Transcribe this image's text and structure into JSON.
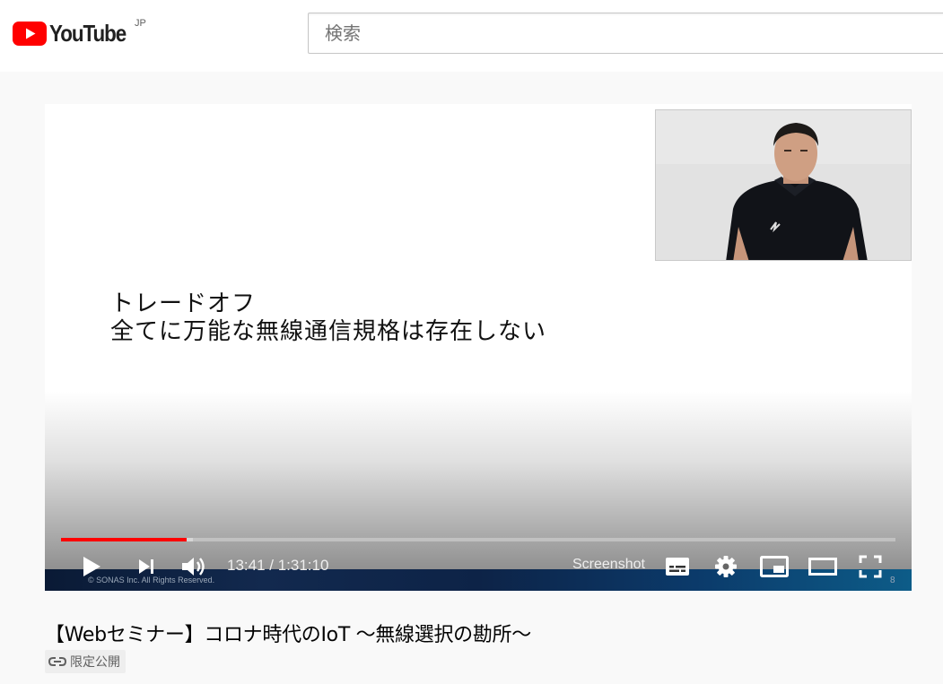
{
  "masthead": {
    "logo_text": "YouTube",
    "country_code": "JP",
    "search_placeholder": "検索",
    "brand_color": "#ff0000"
  },
  "player": {
    "slide": {
      "line1": "トレードオフ",
      "line2": "全てに万能な無線通信規格は存在しない",
      "footer": "© SONAS Inc. All Rights Reserved.",
      "page_number": "8"
    },
    "progress": {
      "played_fraction": 0.151,
      "buffered_fraction": 0.158,
      "played_color": "#ff0000"
    },
    "controls": {
      "current_time": "13:41",
      "separator": " / ",
      "duration": "1:31:10",
      "screenshot_label": "Screenshot",
      "icons": [
        "play-icon",
        "next-icon",
        "volume-icon",
        "subtitles-icon",
        "settings-icon",
        "miniplayer-icon",
        "theater-icon",
        "fullscreen-icon"
      ]
    }
  },
  "video": {
    "title": "【Webセミナー】コロナ時代のIoT ～無線選択の勘所～",
    "privacy_label": "限定公開",
    "privacy_icon": "link-icon"
  }
}
